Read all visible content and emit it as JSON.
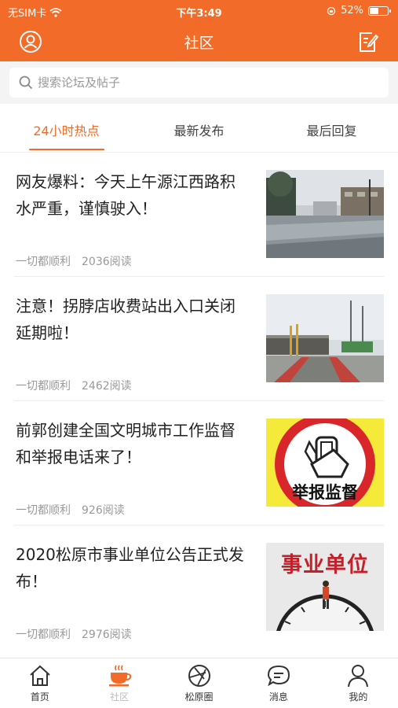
{
  "status_bar": {
    "carrier": "无SIM卡",
    "time": "下午3:49",
    "battery": "52%",
    "battery_level": 0.52
  },
  "header": {
    "title": "社区",
    "user_icon": "user-icon",
    "edit_icon": "edit-icon"
  },
  "search": {
    "placeholder": "搜索论坛及帖子"
  },
  "tabs": [
    {
      "label": "24小时热点"
    },
    {
      "label": "最新发布"
    },
    {
      "label": "最后回复"
    }
  ],
  "posts": [
    {
      "title": "网友爆料：今天上午源江西路积水严重，谨慎驶入！",
      "author": "一切都顺利",
      "reads": "2036阅读"
    },
    {
      "title": "注意！拐脖店收费站出入口关闭延期啦！",
      "author": "一切都顺利",
      "reads": "2462阅读"
    },
    {
      "title": "前郭创建全国文明城市工作监督和举报电话来了！",
      "author": "一切都顺利",
      "reads": "926阅读",
      "image_text": "举报监督"
    },
    {
      "title": "2020松原市事业单位公告正式发布！",
      "author": "一切都顺利",
      "reads": "2976阅读",
      "image_text": "事业单位"
    }
  ],
  "bottom_nav": [
    {
      "label": "首页",
      "icon": "home-icon"
    },
    {
      "label": "社区",
      "icon": "coffee-icon"
    },
    {
      "label": "松原圈",
      "icon": "aperture-icon"
    },
    {
      "label": "消息",
      "icon": "message-icon"
    },
    {
      "label": "我的",
      "icon": "person-icon"
    }
  ],
  "colors": {
    "accent": "#f26b28"
  }
}
